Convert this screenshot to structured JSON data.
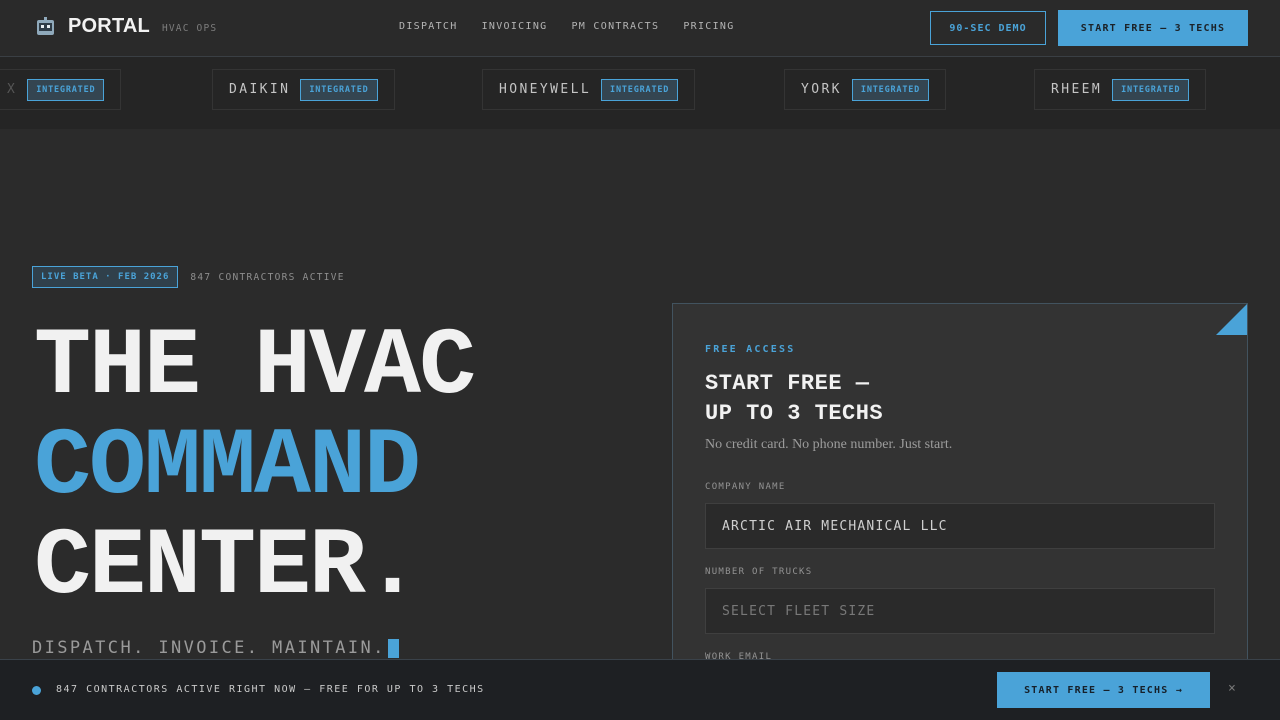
{
  "nav": {
    "brand_name": "PORTAL",
    "brand_tag": "HVAC OPS",
    "links": [
      "DISPATCH",
      "INVOICING",
      "PM CONTRACTS",
      "PRICING"
    ],
    "demo_label": "90-SEC DEMO",
    "start_label": "START FREE — 3 TECHS"
  },
  "strip": {
    "partial_name": "X",
    "partners": [
      {
        "name": "DAIKIN",
        "badge": "INTEGRATED"
      },
      {
        "name": "HONEYWELL",
        "badge": "INTEGRATED"
      },
      {
        "name": "YORK",
        "badge": "INTEGRATED"
      },
      {
        "name": "RHEEM",
        "badge": "INTEGRATED"
      }
    ],
    "partial_badge": "INTEGRATED"
  },
  "hero": {
    "beta_badge": "LIVE BETA · FEB 2026",
    "contractors_active": "847 CONTRACTORS ACTIVE",
    "line1": "THE HVAC",
    "line2": "COMMAND",
    "line3": "CENTER.",
    "tagline": "DISPATCH. INVOICE. MAINTAIN."
  },
  "form": {
    "eyebrow": "FREE ACCESS",
    "title_line1": "START FREE —",
    "title_line2": "UP TO 3 TECHS",
    "subtitle": "No credit card. No phone number. Just start.",
    "company_label": "COMPANY NAME",
    "company_value": "ARCTIC AIR MECHANICAL LLC",
    "trucks_label": "NUMBER OF TRUCKS",
    "trucks_placeholder": "SELECT FLEET SIZE",
    "email_label": "WORK EMAIL"
  },
  "bottom_bar": {
    "text": "847 CONTRACTORS ACTIVE RIGHT NOW — FREE FOR UP TO 3 TECHS",
    "button_label": "START FREE — 3 TECHS →",
    "close": "×"
  },
  "colors": {
    "accent": "#4aa3d8",
    "background": "#2b2b2b",
    "card": "#333333",
    "bottom_bar": "#1e2023"
  }
}
